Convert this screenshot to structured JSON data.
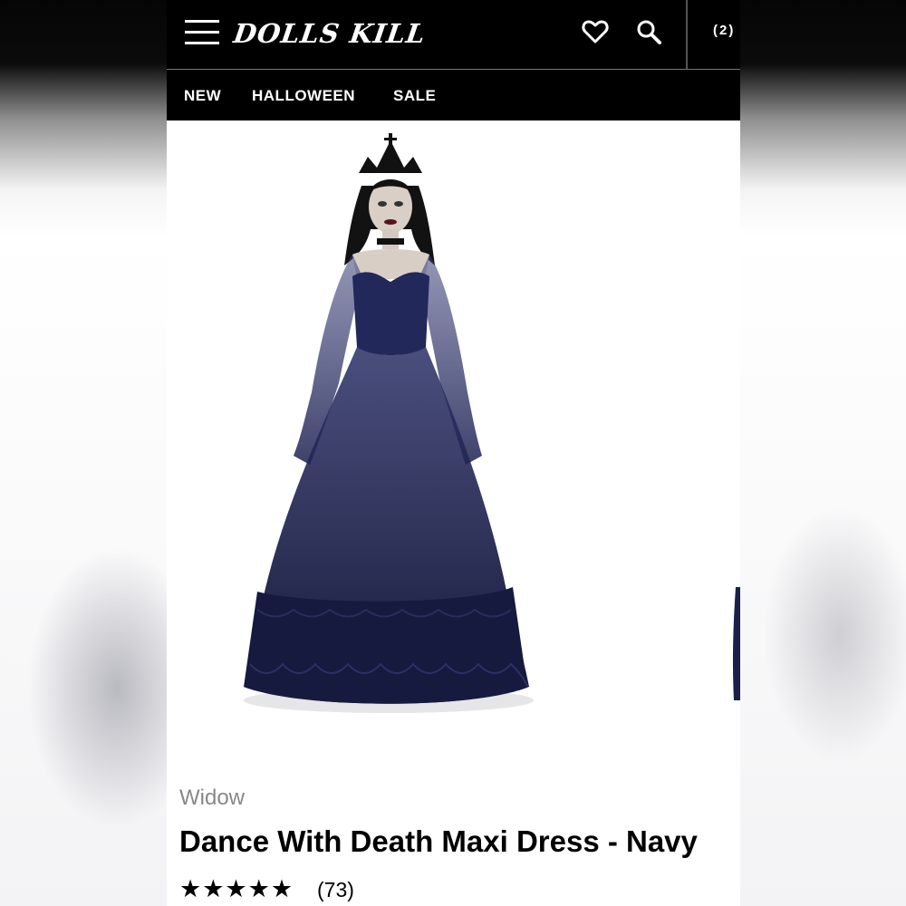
{
  "header": {
    "logo_text": "DOLLS KILL",
    "cart_count": "(2)",
    "icons": [
      "menu-icon",
      "heart-icon",
      "search-icon",
      "cart-icon"
    ]
  },
  "nav": {
    "items": [
      {
        "label": "NEW"
      },
      {
        "label": "HALLOWEEN"
      },
      {
        "label": "SALE"
      }
    ]
  },
  "product": {
    "brand": "Widow",
    "title": "Dance With Death Maxi Dress - Navy",
    "rating": 5,
    "rating_stars": "★★★★★",
    "review_count": "(73)"
  },
  "colors": {
    "header_bg": "#000000",
    "header_text": "#ffffff",
    "dress_navy": "#1b1f4a",
    "brand_gray": "#888888"
  }
}
